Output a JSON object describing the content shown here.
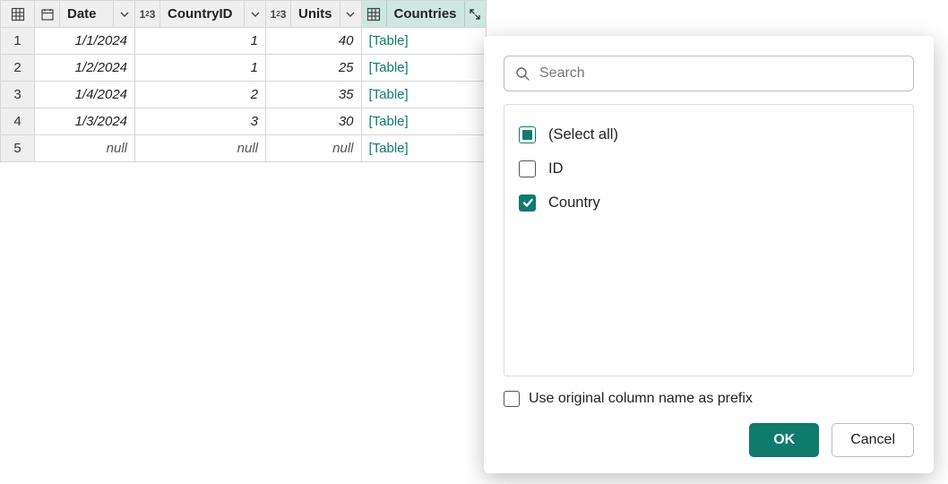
{
  "columns": {
    "date": "Date",
    "countryid": "CountryID",
    "units": "Units",
    "countries": "Countries"
  },
  "rows": [
    {
      "n": "1",
      "date": "1/1/2024",
      "countryid": "1",
      "units": "40",
      "countries": "[Table]"
    },
    {
      "n": "2",
      "date": "1/2/2024",
      "countryid": "1",
      "units": "25",
      "countries": "[Table]"
    },
    {
      "n": "3",
      "date": "1/4/2024",
      "countryid": "2",
      "units": "35",
      "countries": "[Table]"
    },
    {
      "n": "4",
      "date": "1/3/2024",
      "countryid": "3",
      "units": "30",
      "countries": "[Table]"
    },
    {
      "n": "5",
      "date": "null",
      "countryid": "null",
      "units": "null",
      "countries": "[Table]"
    }
  ],
  "popup": {
    "search_placeholder": "Search",
    "options": {
      "select_all": "(Select all)",
      "id": "ID",
      "country": "Country"
    },
    "prefix_label": "Use original column name as prefix",
    "ok": "OK",
    "cancel": "Cancel"
  },
  "colors": {
    "accent": "#0f7b6c"
  }
}
